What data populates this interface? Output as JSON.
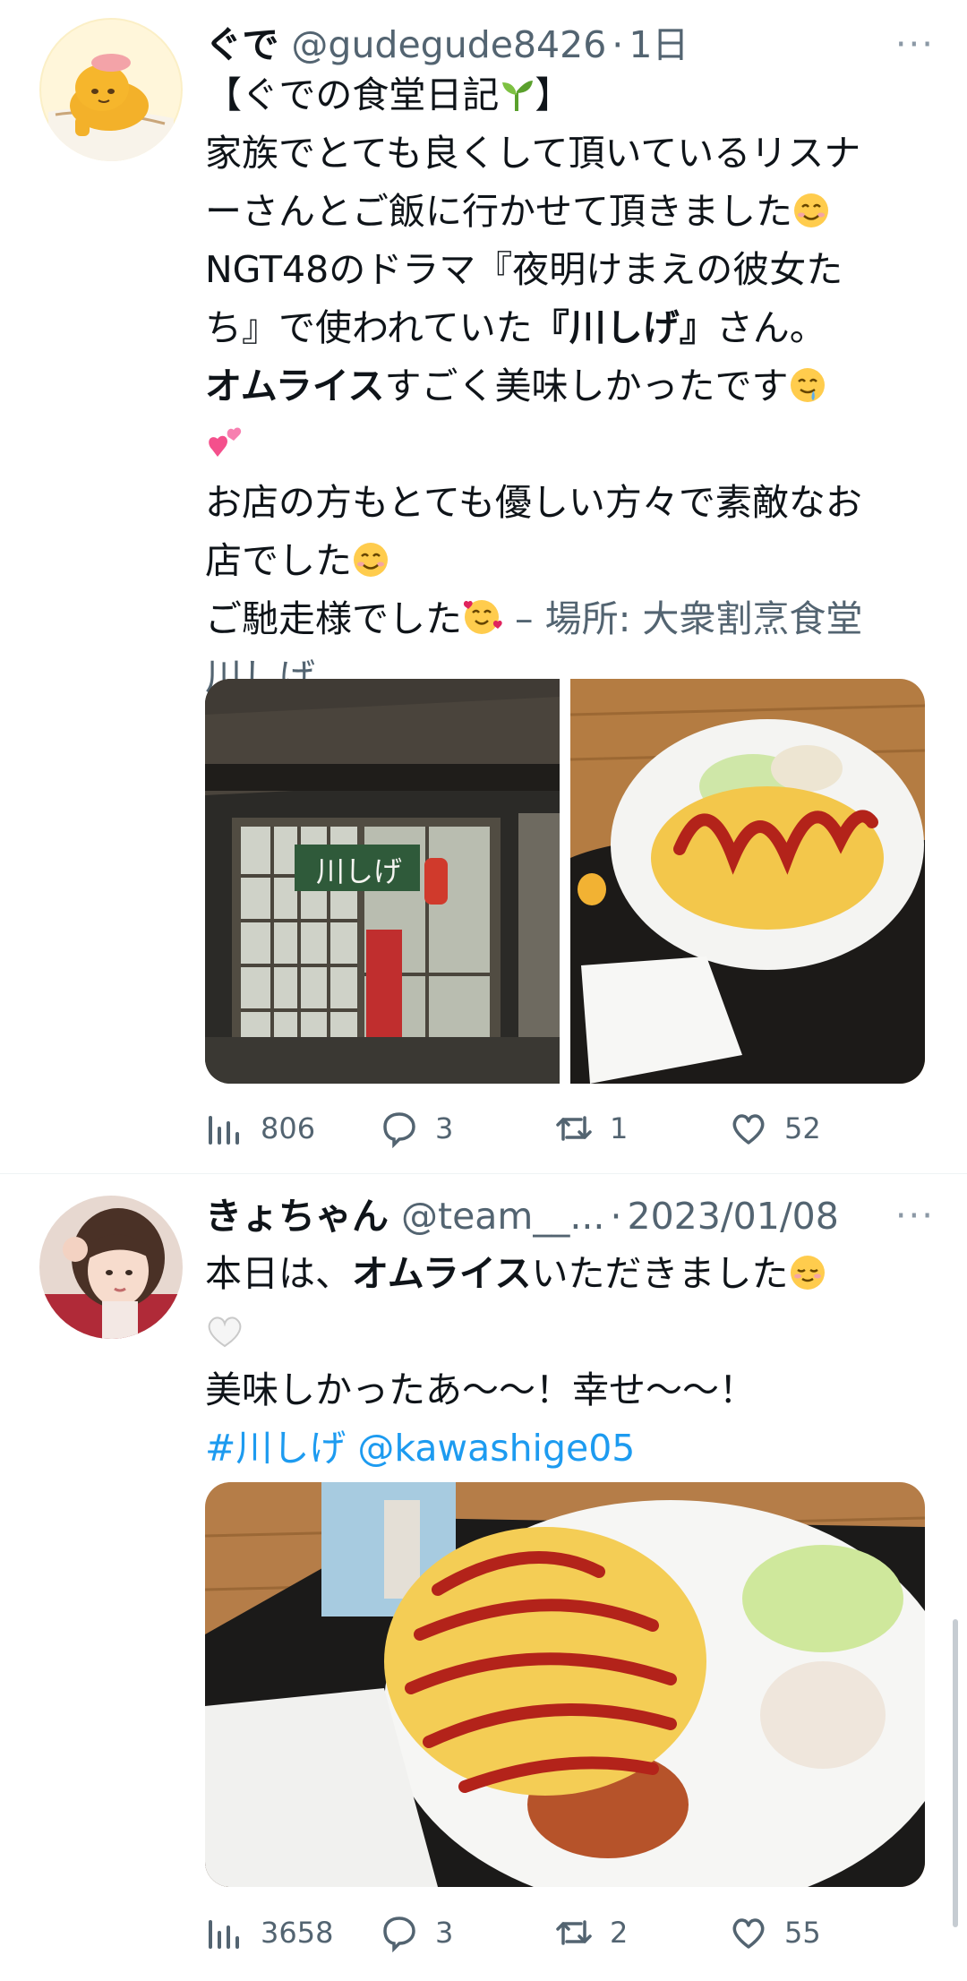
{
  "tweets": [
    {
      "name": "ぐで",
      "handle": "@gudegude8426",
      "dot": "·",
      "time": "1日",
      "more": "···",
      "text": {
        "l1": "【ぐでの食堂日記",
        "l1b": "】",
        "l2": "家族でとても良くして頂いているリスナ",
        "l3": "ーさんとご飯に行かせて頂きました",
        "l4": "NGT48のドラマ『夜明けまえの彼女た",
        "l5a": "ち』で使われていた",
        "l5b": "『川しげ』",
        "l5c": "さん。",
        "l6a": "オムライス",
        "l6b": "すごく美味しかったです",
        "l8": "お店の方もとても優しい方々で素敵なお",
        "l9": "店でした",
        "l10a": "ご馳走様でした",
        "l10b": " – 場所: 大衆割烹食堂",
        "l11": "川しげ"
      },
      "sign_text": "川しげ",
      "stats": {
        "views": "806",
        "replies": "3",
        "retweets": "1",
        "likes": "52"
      }
    },
    {
      "name": "きょちゃん",
      "handle": "@team__...",
      "dot": "·",
      "time": "2023/01/08",
      "more": "···",
      "text": {
        "l1a": "本日は、",
        "l1b": "オムライス",
        "l1c": "いただきました",
        "l3": "美味しかったあ〜〜！幸せ〜〜！",
        "hashtag": "#川しげ",
        "mention": "@kawashige05"
      },
      "stats": {
        "views": "3658",
        "replies": "3",
        "retweets": "2",
        "likes": "55"
      }
    }
  ],
  "icons": [
    "views-icon",
    "reply-icon",
    "retweet-icon",
    "like-icon",
    "more-icon",
    "seedling-emoji",
    "smile-emoji",
    "drool-emoji",
    "hearts-emoji",
    "white-heart-emoji",
    "smiling-hearts-emoji",
    "relieved-emoji"
  ],
  "colors": {
    "text": "#0f1419",
    "secondary": "#536471",
    "link": "#1d9bf0",
    "background": "#ffffff"
  }
}
